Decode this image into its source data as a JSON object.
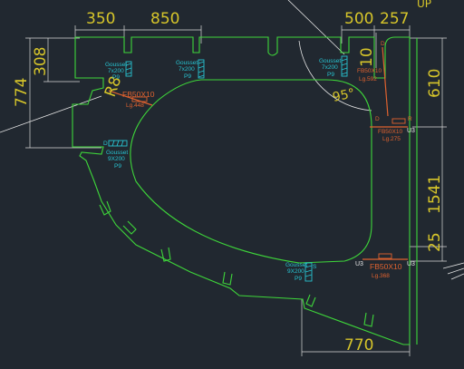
{
  "dimensions": {
    "top_left": "350",
    "top_mid": "850",
    "top_right_a": "500",
    "top_right_b": "257",
    "left_upper": "308",
    "left_lower": "774",
    "right_upper": "610",
    "right_lower": "1541",
    "right_small": "25",
    "inner_10": "10",
    "bottom": "770",
    "radius": "R8"
  },
  "angle": "95°",
  "corner_text": "UP",
  "gussets": [
    {
      "title": "Gousset",
      "size": "7x200",
      "grade": "P9"
    },
    {
      "title": "Gousset",
      "size": "7x200",
      "grade": "P9"
    },
    {
      "title": "Gousset",
      "size": "7x200",
      "grade": "P9"
    },
    {
      "title": "Gousset",
      "size": "9X200",
      "grade": "P9"
    },
    {
      "title": "Gousset",
      "size": "9X200",
      "grade": "P9"
    }
  ],
  "flat_bars": [
    {
      "name": "FB50X10",
      "length": "Lg.448"
    },
    {
      "name": "FB50X10",
      "length": "Lg.592"
    },
    {
      "name": "FB50X10",
      "length": "Lg.275"
    },
    {
      "name": "FB50X10",
      "length": "Lg.368"
    }
  ],
  "small_labels": {
    "u3_a": "U3",
    "u3_b": "U3",
    "u3_c": "U3",
    "d": "D",
    "s": "S",
    "r": "R"
  }
}
